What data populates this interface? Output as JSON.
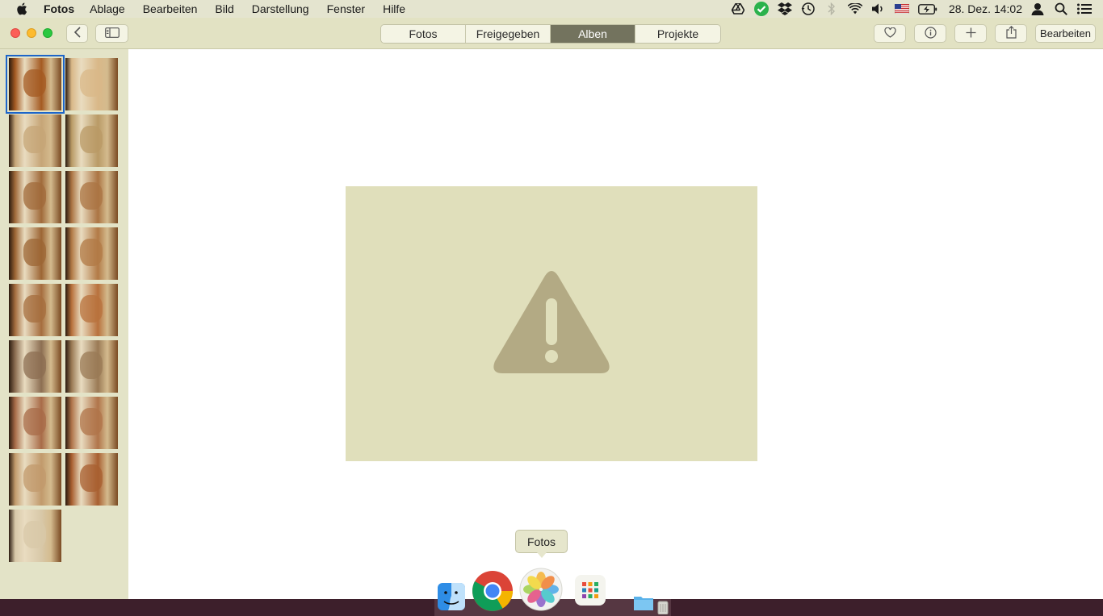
{
  "menubar": {
    "app_name": "Fotos",
    "items": [
      "Ablage",
      "Bearbeiten",
      "Bild",
      "Darstellung",
      "Fenster",
      "Hilfe"
    ],
    "clock": "28. Dez. 14:02",
    "status_icons": [
      "google-drive-icon",
      "check-circle-icon",
      "dropbox-icon",
      "time-machine-icon",
      "bluetooth-icon",
      "wifi-icon",
      "volume-icon",
      "us-flag-icon",
      "battery-charging-icon",
      "user-icon",
      "spotlight-search-icon",
      "notification-center-icon"
    ]
  },
  "toolbar": {
    "tabs": [
      {
        "label": "Fotos",
        "active": false
      },
      {
        "label": "Freigegeben",
        "active": false
      },
      {
        "label": "Alben",
        "active": true
      },
      {
        "label": "Projekte",
        "active": false
      }
    ],
    "edit_label": "Bearbeiten"
  },
  "main": {
    "state": "image-unavailable"
  },
  "dock": {
    "tooltip": "Fotos",
    "apps": [
      "finder-icon",
      "chrome-icon",
      "photos-icon",
      "launchpad-icon",
      "folder-icon",
      "trash-icon"
    ]
  },
  "colors": {
    "menubar_bg": "#e4e4cf",
    "toolbar_bg": "#e2e2c3",
    "sidebar_bg": "#e3e3c7",
    "active_tab": "#73735e",
    "selection": "#1d65c9",
    "placeholder_bg": "#e0dfbb",
    "warning_glyph": "#b3aa84"
  },
  "thumbnails": [
    {
      "selected": true,
      "tone": "#a45a22"
    },
    {
      "selected": false,
      "tone": "#d9b888"
    },
    {
      "selected": false,
      "tone": "#c6a577"
    },
    {
      "selected": false,
      "tone": "#b99a66"
    },
    {
      "selected": false,
      "tone": "#a06a3a"
    },
    {
      "selected": false,
      "tone": "#ab7443"
    },
    {
      "selected": false,
      "tone": "#9c6534"
    },
    {
      "selected": false,
      "tone": "#b27a46"
    },
    {
      "selected": false,
      "tone": "#a56d3e"
    },
    {
      "selected": false,
      "tone": "#b8713c"
    },
    {
      "selected": false,
      "tone": "#8c6e52"
    },
    {
      "selected": false,
      "tone": "#9a7a55"
    },
    {
      "selected": false,
      "tone": "#a86b48"
    },
    {
      "selected": false,
      "tone": "#b0744a"
    },
    {
      "selected": false,
      "tone": "#c19a6c"
    },
    {
      "selected": false,
      "tone": "#a85f30"
    },
    {
      "selected": false,
      "tone": "#d8c8a8"
    }
  ]
}
